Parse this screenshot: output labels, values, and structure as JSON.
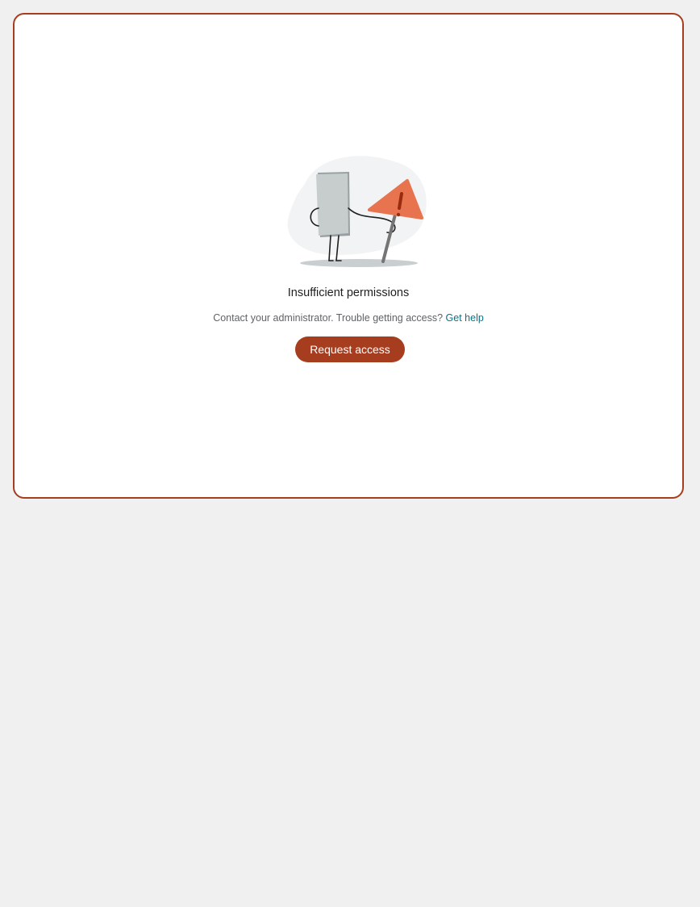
{
  "dialog": {
    "title": "Insufficient permissions",
    "message": "Contact your administrator. Trouble getting access?",
    "help_link": "Get help",
    "request_button": "Request access",
    "illustration_icon": "warning-sign-character-icon"
  },
  "colors": {
    "accent": "#a63d1e",
    "warning_sign": "#e8734f",
    "link": "#0b7285",
    "page_background": "#f0f0f0",
    "card_background": "#ffffff"
  }
}
